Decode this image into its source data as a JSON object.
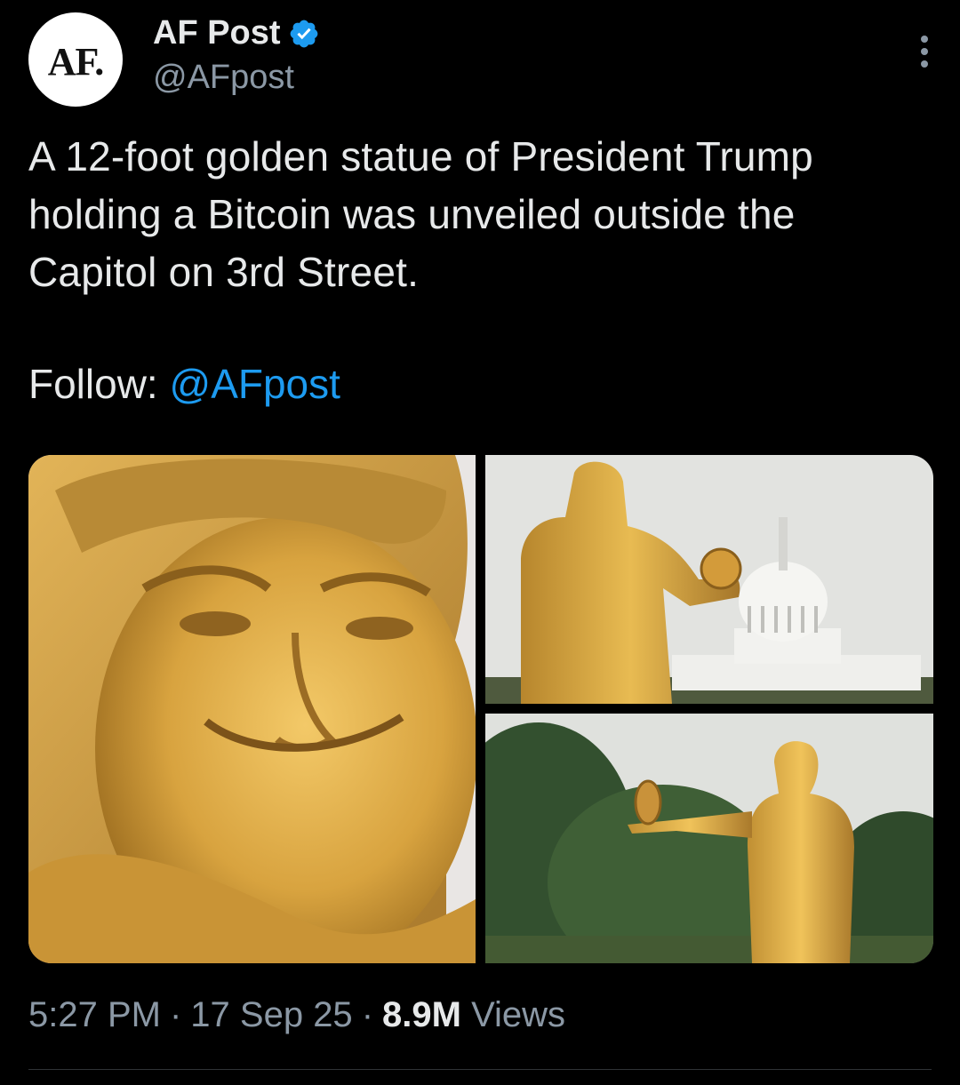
{
  "author": {
    "avatar_text": "AF.",
    "display_name": "AF Post",
    "handle": "@AFpost",
    "verified_icon": "verified-badge-icon"
  },
  "tweet": {
    "text": "A 12-foot golden statue of President Trump holding a Bitcoin was unveiled outside the Capitol on 3rd Street.",
    "follow_label": "Follow:",
    "follow_mention": "@AFpost"
  },
  "media": {
    "count": 3,
    "images": [
      "statue-face-closeup",
      "statue-back-with-capitol",
      "statue-full-body-trees"
    ]
  },
  "meta": {
    "time": "5:27 PM",
    "date": "17 Sep 25",
    "views_count": "8.9M",
    "views_label": "Views",
    "separator": "·"
  },
  "colors": {
    "background": "#000000",
    "text": "#e7e9ea",
    "secondary": "#8b98a5",
    "link": "#1d9bf0",
    "gold": "#d4a53a"
  }
}
